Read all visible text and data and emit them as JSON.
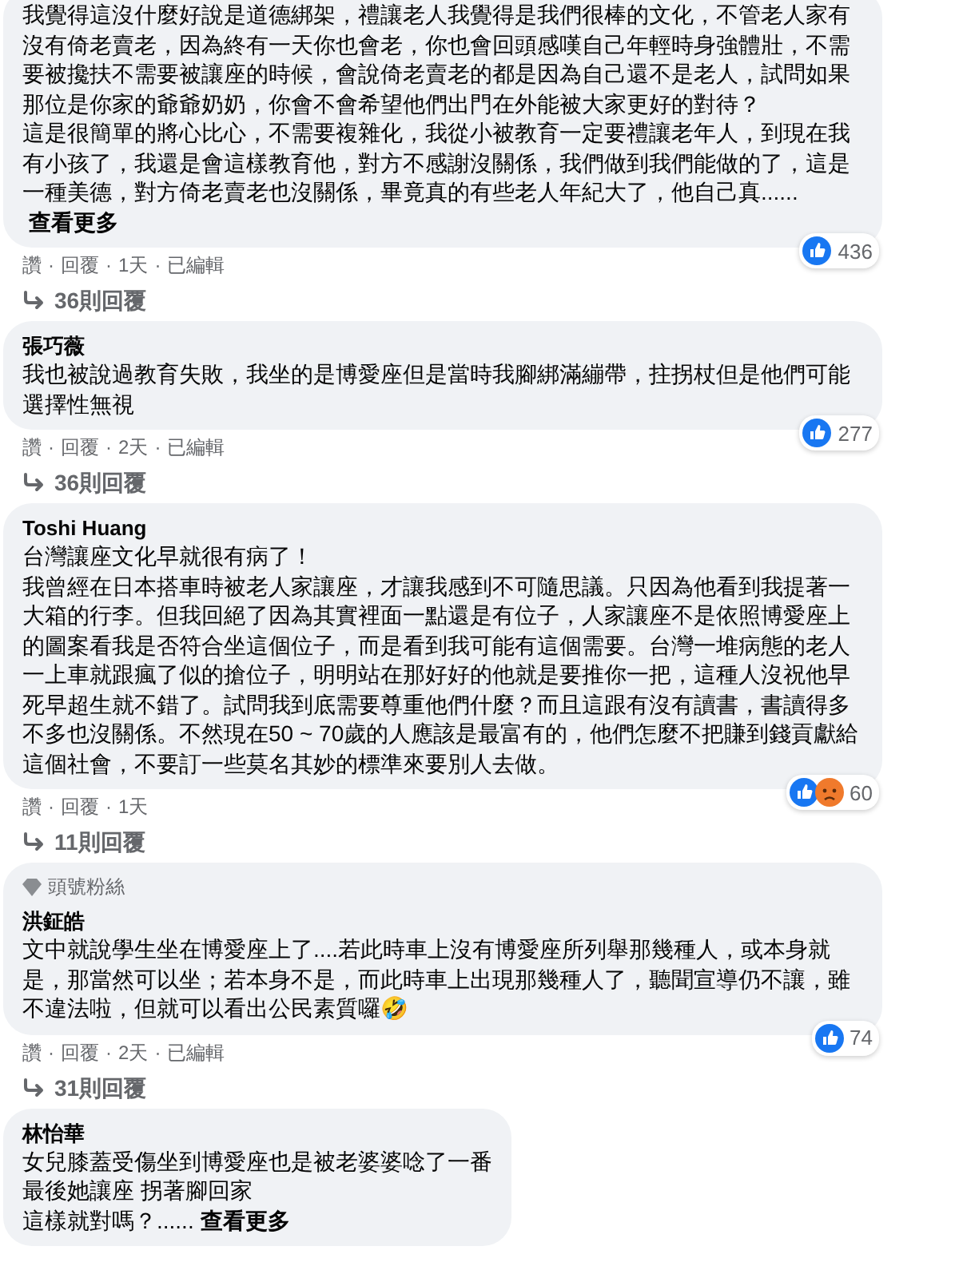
{
  "comments": [
    {
      "paragraphs": [
        "我覺得這沒什麼好說是道德綁架，禮讓老人我覺得是我們很棒的文化，不管老人家有沒有倚老賣老，因為終有一天你也會老，你也會回頭感嘆自己年輕時身強體壯，不需要被攙扶不需要被讓座的時候，會說倚老賣老的都是因為自己還不是老人，試問如果那位是你家的爺爺奶奶，你會不會希望他們出門在外能被大家更好的對待？",
        "這是很簡單的將心比心，不需要複雜化，我從小被教育一定要禮讓老年人，到現在我有小孩了，我還是會這樣教育他，對方不感謝沒關係，我們做到我們能做的了，這是一種美德，對方倚老賣老也沒關係，畢竟真的有些老人年紀大了，他自己真......"
      ],
      "see_more": "查看更多",
      "reactions": [
        {
          "kind": "like"
        }
      ],
      "reaction_count": "436",
      "separator": "·",
      "actions": [
        "讚",
        "回覆",
        "1天",
        "已編輯"
      ],
      "replies": "36則回覆"
    },
    {
      "name": "張巧薇",
      "paragraphs": [
        "我也被說過教育失敗，我坐的是博愛座但是當時我腳綁滿繃帶，拄拐杖但是他們可能選擇性無視"
      ],
      "reactions": [
        {
          "kind": "like"
        }
      ],
      "reaction_count": "277",
      "separator": "·",
      "actions": [
        "讚",
        "回覆",
        "2天",
        "已編輯"
      ],
      "replies": "36則回覆"
    },
    {
      "name": "Toshi Huang",
      "paragraphs": [
        "台灣讓座文化早就很有病了！",
        "我曾經在日本搭車時被老人家讓座，才讓我感到不可隨思議。只因為他看到我提著一大箱的行李。但我回絕了因為其實裡面一點還是有位子，人家讓座不是依照博愛座上的圖案看我是否符合坐這個位子，而是看到我可能有這個需要。台灣一堆病態的老人一上車就跟瘋了似的搶位子，明明站在那好好的他就是要推你一把，這種人沒祝他早死早超生就不錯了。試問我到底需要尊重他們什麼？而且這跟有沒有讀書，書讀得多不多也沒關係。不然現在50 ~ 70歲的人應該是最富有的，他們怎麼不把賺到錢貢獻給這個社會，不要訂一些莫名其妙的標準來要別人去做。"
      ],
      "reactions": [
        {
          "kind": "like"
        },
        {
          "kind": "sad"
        }
      ],
      "reaction_count": "60",
      "separator": "·",
      "actions": [
        "讚",
        "回覆",
        "1天"
      ],
      "replies": "11則回覆"
    },
    {
      "badge": "頭號粉絲",
      "name": "洪鉦皓",
      "paragraphs": [
        "文中就說學生坐在博愛座上了....若此時車上沒有博愛座所列舉那幾種人，或本身就是，那當然可以坐；若本身不是，而此時車上出現那幾種人了，聽聞宣導仍不讓，雖不違法啦，但就可以看出公民素質囉🤣"
      ],
      "reactions": [
        {
          "kind": "like"
        }
      ],
      "reaction_count": "74",
      "separator": "·",
      "actions": [
        "讚",
        "回覆",
        "2天",
        "已編輯"
      ],
      "replies": "31則回覆"
    },
    {
      "name": "林怡華",
      "paragraphs": [
        "女兒膝蓋受傷坐到博愛座也是被老婆婆唸了一番",
        "最後她讓座 拐著腳回家",
        "這樣就對嗎？......"
      ],
      "see_more": "查看更多"
    }
  ]
}
